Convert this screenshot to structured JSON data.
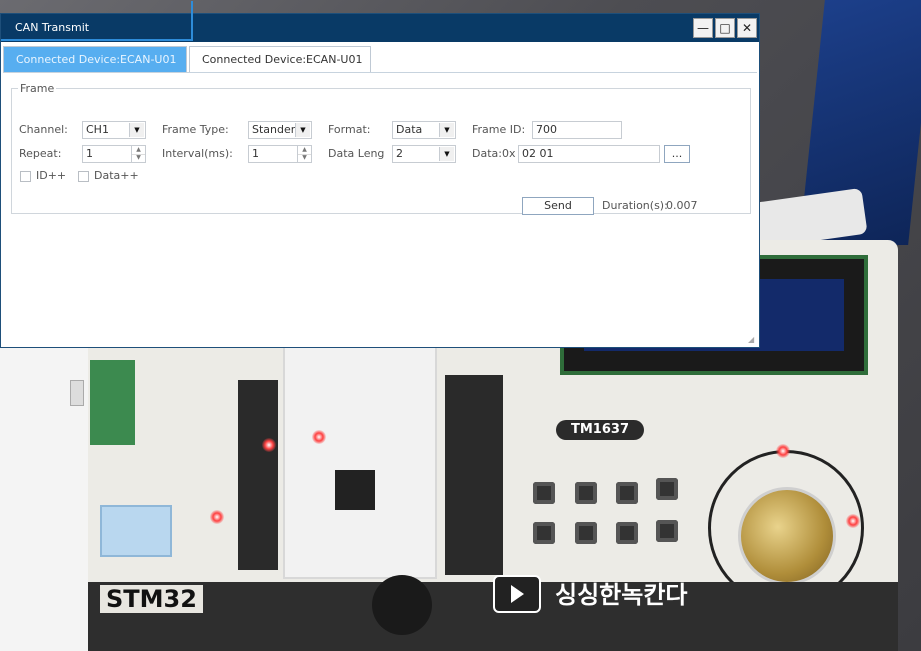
{
  "window": {
    "title": "CAN Transmit",
    "controls": {
      "minimize": "—",
      "maximize": "□",
      "close": "✕"
    }
  },
  "tabs": [
    {
      "label": "Connected Device:ECAN-U01",
      "active": true
    },
    {
      "label": "Connected Device:ECAN-U01",
      "active": false
    }
  ],
  "frame": {
    "legend": "Frame",
    "channel": {
      "label": "Channel:",
      "value": "CH1"
    },
    "frame_type": {
      "label": "Frame Type:",
      "value": "Stander"
    },
    "format": {
      "label": "Format:",
      "value": "Data"
    },
    "frame_id": {
      "label": "Frame ID:",
      "value": "700"
    },
    "repeat": {
      "label": "Repeat:",
      "value": "1"
    },
    "interval": {
      "label": "Interval(ms):",
      "value": "1"
    },
    "data_length": {
      "label": "Data Leng",
      "value": "2"
    },
    "data": {
      "label": "Data:0x",
      "value": "02 01",
      "browse_label": "..."
    },
    "id_increment": {
      "label": "ID++",
      "checked": false
    },
    "data_increment": {
      "label": "Data++",
      "checked": false
    },
    "send_label": "Send",
    "duration": {
      "label": "Duration(s):",
      "value": "0.007"
    }
  },
  "icons": {
    "combo_arrow": "▼",
    "spin_up": "▲",
    "spin_down": "▼",
    "resize_grip": "◢"
  },
  "background": {
    "board_chip_label": "TM1637",
    "board_banner_text": "싱싱한녹칸다",
    "board_shield_text": "STM32",
    "colors": {
      "title_bar": "#093a66",
      "active_tab": "#57aef0",
      "led": "#ff4040"
    }
  }
}
